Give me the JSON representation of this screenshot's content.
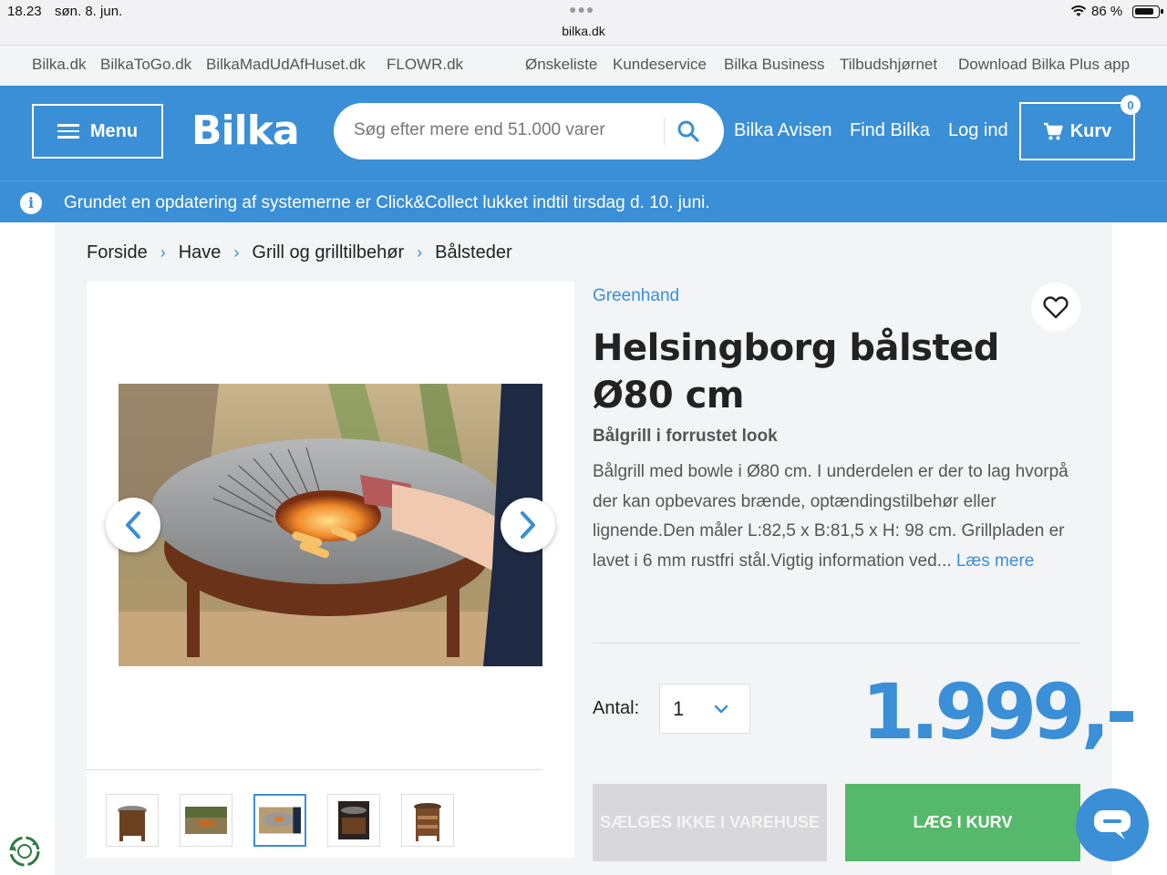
{
  "status_bar": {
    "time": "18.23",
    "date": "søn. 8. jun.",
    "url": "bilka.dk",
    "battery_text": "86 %",
    "battery_level": 0.86
  },
  "top_links": {
    "left": [
      "Bilka.dk",
      "BilkaToGo.dk",
      "BilkaMadUdAfHuset.dk",
      "FLOWR.dk"
    ],
    "right": [
      "Ønskeliste",
      "Kundeservice",
      "Bilka Business",
      "Tilbudshjørnet",
      "Download Bilka Plus app"
    ]
  },
  "header": {
    "menu_label": "Menu",
    "logo_text": "Bilka",
    "search_placeholder": "Søg efter mere end 51.000 varer",
    "links": [
      "Bilka Avisen",
      "Find Bilka",
      "Log ind"
    ],
    "cart_label": "Kurv",
    "cart_count": "0",
    "notice": "Grundet en opdatering af systemerne er Click&Collect lukket indtil tirsdag d. 10. juni."
  },
  "breadcrumb": [
    "Forside",
    "Have",
    "Grill og grilltilbehør",
    "Bålsteder"
  ],
  "product": {
    "brand": "Greenhand",
    "title": "Helsingborg bålsted Ø80 cm",
    "subtitle": "Bålgrill i forrustet look",
    "description": "Bålgrill med bowle i Ø80 cm. I underdelen er der to lag hvorpå der kan opbevares brænde, optændingstilbehør eller lignende.Den måler L:82,5 x B:81,5 x H: 98 cm. Grillpladen er lavet i 6 mm rustfri stål.Vigtig information ved...",
    "read_more": "Læs mere",
    "quantity_label": "Antal:",
    "quantity_value": "1",
    "price": "1.999,-",
    "store_button": "SÆLGES IKKE I VAREHUSE",
    "cart_button": "LÆG I KURV"
  },
  "gallery": {
    "thumbnail_count": 5,
    "active_thumbnail": 3
  },
  "colors": {
    "brand_blue": "#3a8fd6",
    "cart_green": "#55b86a",
    "disabled_gray": "#d8d8da"
  }
}
